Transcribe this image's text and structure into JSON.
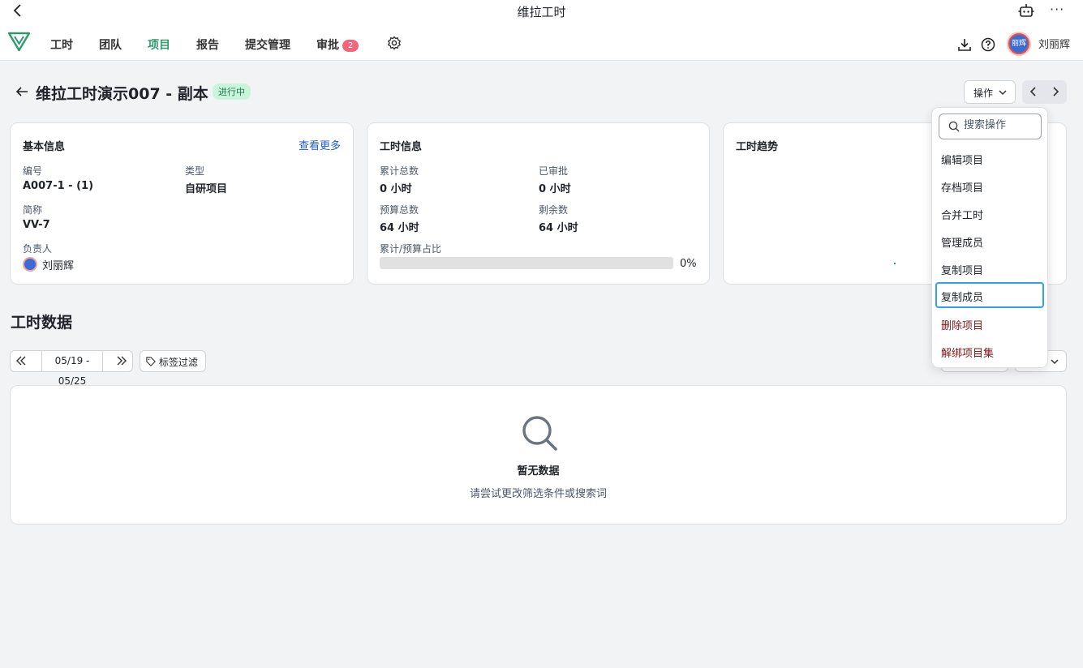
{
  "window": {
    "title": "维拉工时"
  },
  "nav": {
    "items": [
      {
        "label": "工时"
      },
      {
        "label": "团队"
      },
      {
        "label": "项目"
      },
      {
        "label": "报告"
      },
      {
        "label": "提交管理"
      },
      {
        "label": "审批",
        "badge": "2"
      }
    ],
    "active": "项目",
    "user_name": "刘丽辉",
    "avatar_text": "丽辉"
  },
  "project": {
    "title": "维拉工时演示007 - 副本",
    "status": "进行中",
    "ops_label": "操作"
  },
  "basic_info": {
    "title": "基本信息",
    "more_link": "查看更多",
    "id_label": "编号",
    "id_value": "A007-1 - (1)",
    "type_label": "类型",
    "type_value": "自研项目",
    "short_label": "简称",
    "short_value": "VV-7",
    "owner_label": "负责人",
    "owner_value": "刘丽辉"
  },
  "hours_info": {
    "title": "工时信息",
    "total_label": "累计总数",
    "total_value": "0 小时",
    "approved_label": "已审批",
    "approved_value": "0 小时",
    "budget_label": "预算总数",
    "budget_value": "64 小时",
    "remaining_label": "剩余数",
    "remaining_value": "64 小时",
    "ratio_label": "累计/预算占比",
    "ratio_value": "0%",
    "ratio_percent": 0
  },
  "trend": {
    "title": "工时趋势"
  },
  "hours_data": {
    "title": "工时数据",
    "date_range": "05/19 - 05/25",
    "tag_filter": "标签过滤",
    "empty_title": "暂无数据",
    "empty_subtitle": "请尝试更改筛选条件或搜索词"
  },
  "dropdown": {
    "search_placeholder": "搜索操作",
    "items": [
      {
        "label": "编辑项目"
      },
      {
        "label": "存档项目"
      },
      {
        "label": "合并工时"
      },
      {
        "label": "管理成员"
      },
      {
        "label": "复制项目"
      },
      {
        "label": "复制成员"
      },
      {
        "label": "删除项目"
      },
      {
        "label": "解绑项目集"
      }
    ]
  },
  "colors": {
    "accent": "#2e9b6c",
    "link": "#1d5bd6",
    "danger": "#8a1414",
    "focus": "#2ea3ea",
    "badge": "#f2657a"
  }
}
